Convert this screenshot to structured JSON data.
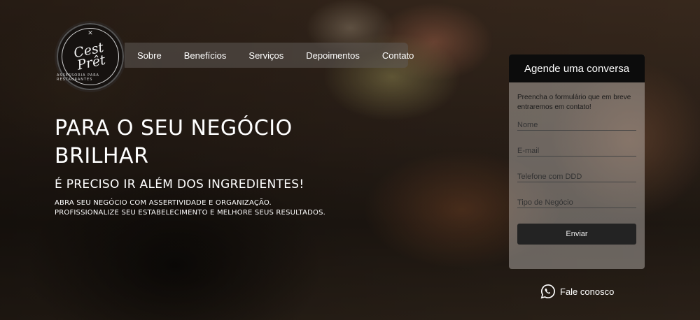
{
  "brand": {
    "logo_line1": "Cest",
    "logo_line2": "Prêt",
    "logo_sub": "ASSESSORIA PARA RESTAURANTES"
  },
  "nav": {
    "items": [
      "Sobre",
      "Benefícios",
      "Serviços",
      "Depoimentos",
      "Contato"
    ]
  },
  "hero": {
    "title": "PARA O SEU NEGÓCIO BRILHAR",
    "subtitle": "É PRECISO IR ALÉM DOS INGREDIENTES!",
    "desc_line1": "ABRA SEU NEGÓCIO COM ASSERTIVIDADE E ORGANIZAÇÃO.",
    "desc_line2": "PROFISSIONALIZE SEU ESTABELECIMENTO E MELHORE SEUS RESULTADOS."
  },
  "form": {
    "title": "Agende uma conversa",
    "intro": "Preencha o formulário que em breve entraremos em contato!",
    "name_placeholder": "Nome",
    "email_placeholder": "E-mail",
    "phone_placeholder": "Telefone com DDD",
    "business_placeholder": "Tipo de Negócio",
    "submit_label": "Enviar"
  },
  "whatsapp": {
    "label": "Fale conosco",
    "icon": "whatsapp-icon"
  },
  "colors": {
    "form_header": "#0c0c0c",
    "submit_bg": "#232323"
  }
}
